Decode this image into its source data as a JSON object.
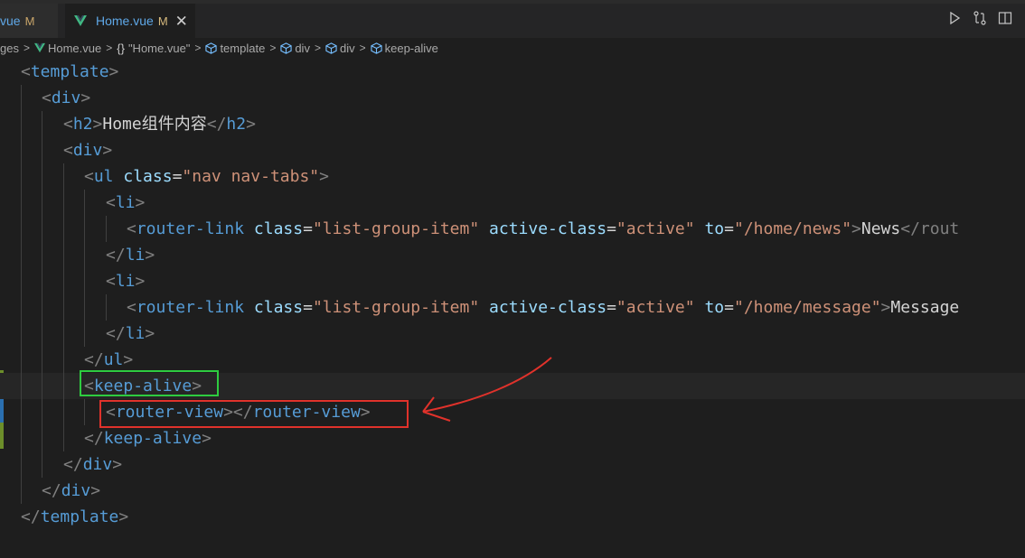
{
  "tabs": [
    {
      "name": "vue",
      "status": "M",
      "active": false
    },
    {
      "name": "Home.vue",
      "status": "M",
      "active": true
    }
  ],
  "icons": {
    "vue": "vue-logo-icon",
    "close": "close-icon",
    "run": "play-icon",
    "compare": "compare-changes-icon",
    "split": "split-editor-icon",
    "element": "element-cube-icon"
  },
  "close_label": "✕",
  "breadcrumbs": {
    "folder": "ges",
    "file": "Home.vue",
    "braces": "{}",
    "block": "\"Home.vue\"",
    "items": [
      "template",
      "div",
      "div",
      "keep-alive"
    ]
  },
  "code": {
    "l1": {
      "tag": "template"
    },
    "l2": {
      "tag": "div"
    },
    "l3": {
      "tag": "h2",
      "text": "Home组件内容",
      "close": "h2"
    },
    "l4": {
      "tag": "div"
    },
    "l5": {
      "tag": "ul",
      "attr": "class",
      "value": "\"nav nav-tabs\""
    },
    "l6": {
      "tag": "li"
    },
    "l7": {
      "tag": "router-link",
      "attr1": "class",
      "value1": "\"list-group-item\"",
      "attr2": "active-class",
      "value2": "\"active\"",
      "attr3": "to",
      "value3": "\"/home/news\"",
      "text": "News",
      "tail": "</rout"
    },
    "l8": {
      "tag": "li"
    },
    "l9": {
      "tag": "li"
    },
    "l10": {
      "tag": "router-link",
      "attr1": "class",
      "value1": "\"list-group-item\"",
      "attr2": "active-class",
      "value2": "\"active\"",
      "attr3": "to",
      "value3": "\"/home/message\"",
      "text": "Message"
    },
    "l11": {
      "tag": "li"
    },
    "l12": {
      "tag": "ul"
    },
    "l13": {
      "tag": "keep-alive"
    },
    "l14": {
      "tag": "router-view",
      "close": "router-view"
    },
    "l15": {
      "tag": "keep-alive"
    },
    "l16": {
      "tag": "div"
    },
    "l17": {
      "tag": "div"
    },
    "l18": {
      "tag": "template"
    }
  },
  "colors": {
    "tag": "#569cd6",
    "attribute": "#9cdcfe",
    "string": "#ce9178",
    "highlight_green": "#2ecc40",
    "highlight_red": "#e0322b"
  }
}
